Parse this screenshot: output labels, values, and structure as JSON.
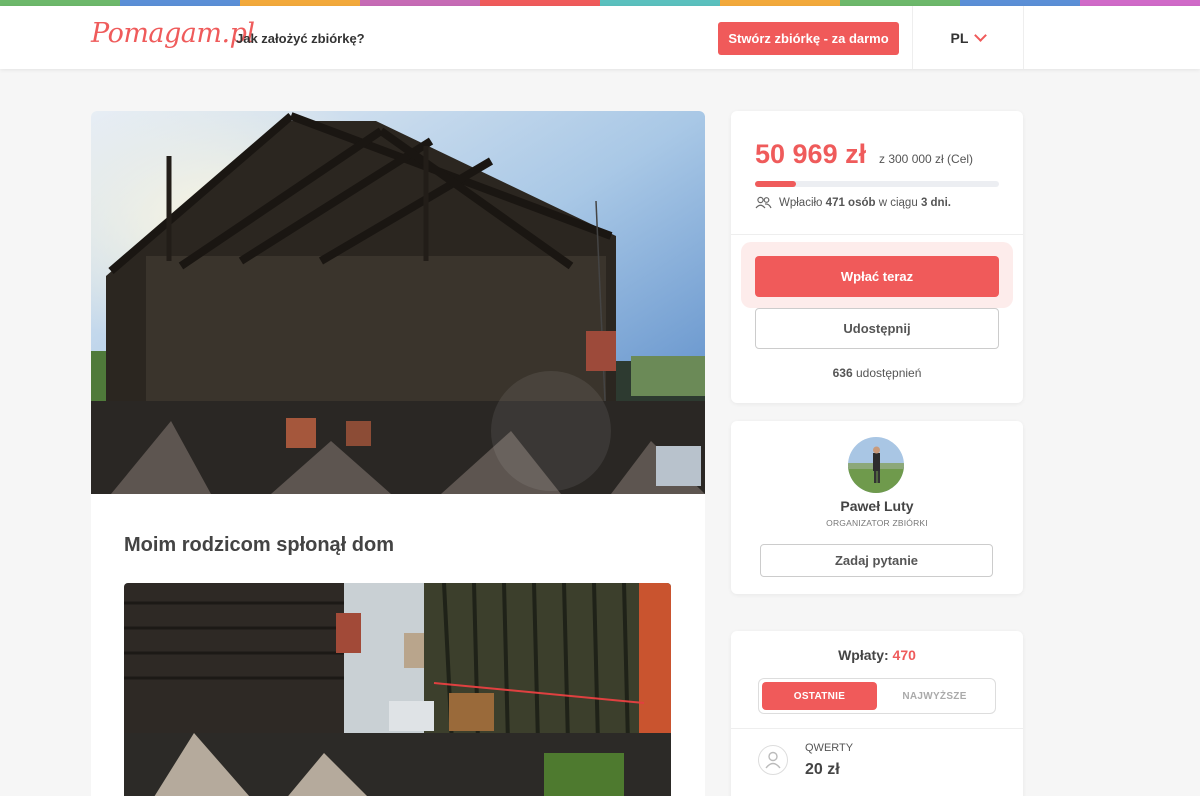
{
  "colors": {
    "accent": "#f05a5a",
    "stripe": [
      "#6db86b",
      "#5b8fd6",
      "#f2a93b",
      "#c66bb5",
      "#ef5b5b",
      "#5bc0be",
      "#f2a93b",
      "#6db86b",
      "#5b8fd6",
      "#d06ac8"
    ]
  },
  "header": {
    "logo": "Pomagam.pl",
    "howto": "Jak założyć zbiórkę?",
    "cta": "Stwórz zbiórkę - za darmo",
    "lang": "PL"
  },
  "campaign": {
    "title": "Moim rodzicom spłonął dom",
    "hero_image": "burned-house-photo",
    "second_image": "burned-rubble-photo"
  },
  "funding": {
    "amount": "50 969 zł",
    "goal": "z 300 000 zł (Cel)",
    "progress": 0.17,
    "donors_prefix": "Wpłaciło",
    "donors_count": "471 osób",
    "donors_mid": "w ciągu",
    "donors_days": "3 dni.",
    "pay_button": "Wpłać teraz",
    "share_button": "Udostępnij",
    "shares_count": "636",
    "shares_label": "udostępnień"
  },
  "organizer": {
    "name": "Paweł Luty",
    "role": "ORGANIZATOR ZBIÓRKI",
    "ask_button": "Zadaj pytanie"
  },
  "payments": {
    "label": "Wpłaty:",
    "count": "470",
    "tabs": [
      "OSTATNIE",
      "NAJWYŻSZE"
    ],
    "items": [
      {
        "name": "QWERTY",
        "amount": "20 zł"
      }
    ]
  }
}
